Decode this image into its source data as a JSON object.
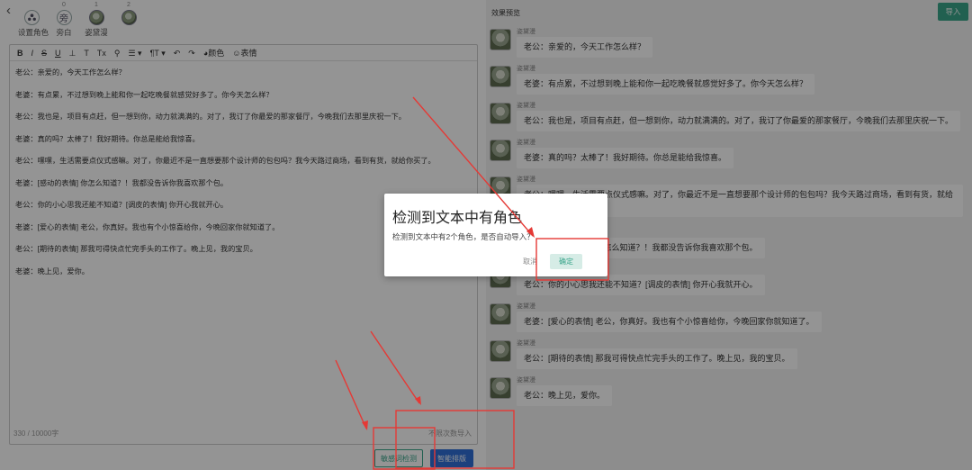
{
  "header": {
    "back_icon": "chevron-left-icon",
    "roles": [
      {
        "count": "",
        "label": "设置角色",
        "icon": "people-icon"
      },
      {
        "count": "0",
        "label": "旁白",
        "glyph": "旁"
      },
      {
        "count": "1",
        "label": "姿黛漫",
        "icon": "avatar-photo"
      },
      {
        "count": "2",
        "label": "",
        "icon": "avatar-photo"
      }
    ]
  },
  "toolbar": {
    "items": [
      "B",
      "I",
      "S",
      "U",
      "⊥",
      "T",
      "Tx",
      "⚲",
      "☰ ▾",
      "¶T ▾",
      "↶",
      "↷"
    ],
    "color_label": "颜色",
    "emoji_label": "表情"
  },
  "editor": {
    "lines": [
      "老公：亲爱的，今天工作怎么样？",
      "老婆：有点累，不过想到晚上能和你一起吃晚餐就感觉好多了。你今天怎么样？",
      "老公：我也是，项目有点赶，但一想到你，动力就满满的。对了，我订了你最爱的那家餐厅，今晚我们去那里庆祝一下。",
      "老婆：真的吗？太棒了！我好期待。你总是能给我惊喜。",
      "老公：嘿嘿，生活需要点仪式感嘛。对了，你最近不是一直想要那个设计师的包包吗？我今天路过商场，看到有货，就给你买了。",
      "老婆：[感动的表情] 你怎么知道？！我都没告诉你我喜欢那个包。",
      "老公：你的小心思我还能不知道？[调皮的表情] 你开心我就开心。",
      "老婆：[爱心的表情] 老公，你真好。我也有个小惊喜给你，今晚回家你就知道了。",
      "老公：[期待的表情] 那我可得快点忙完手头的工作了。晚上见，我的宝贝。",
      "老婆：晚上见，爱你。"
    ],
    "char_count": "330 / 10000字",
    "import_hint": "不限次数导入"
  },
  "buttons": {
    "detect_label": "敏感词检测",
    "smart_label": "智能排版"
  },
  "preview": {
    "title": "效果预览",
    "import_label": "导入",
    "nickname": "姿黛漫",
    "messages": [
      "老公：亲爱的，今天工作怎么样？",
      "老婆：有点累，不过想到晚上能和你一起吃晚餐就感觉好多了。你今天怎么样？",
      "老公：我也是，项目有点赶，但一想到你，动力就满满的。对了，我订了你最爱的那家餐厅，今晚我们去那里庆祝一下。",
      "老婆：真的吗？太棒了！我好期待。你总是能给我惊喜。",
      "老公：嘿嘿，生活需要点仪式感嘛。对了，你最近不是一直想要那个设计师的包包吗？我今天路过商场，看到有货，就给你买了。",
      "老婆：[感动的表情] 你怎么知道？！我都没告诉你我喜欢那个包。",
      "老公：你的小心思我还能不知道？[调皮的表情] 你开心我就开心。",
      "老婆：[爱心的表情] 老公，你真好。我也有个小惊喜给你，今晚回家你就知道了。",
      "老公：[期待的表情] 那我可得快点忙完手头的工作了。晚上见，我的宝贝。",
      "老公：晚上见，爱你。"
    ]
  },
  "dialog": {
    "title": "检测到文本中有角色",
    "body": "检测到文本中有2个角色，是否自动导入？",
    "cancel_label": "取消",
    "ok_label": "确定"
  },
  "colors": {
    "accent": "#3aa58b",
    "primary_button": "#2f6fd8",
    "annotation": "#e53935"
  }
}
